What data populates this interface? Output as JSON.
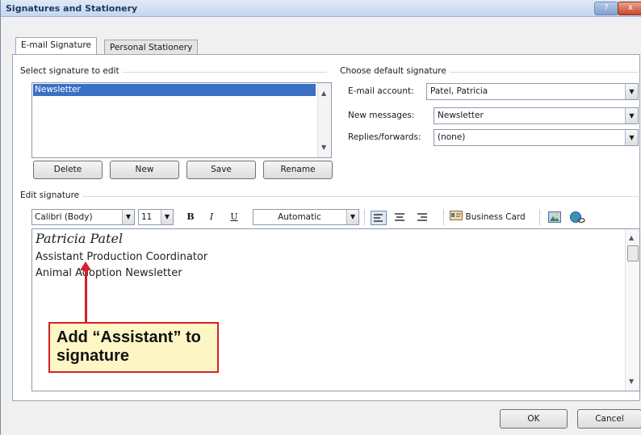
{
  "window": {
    "title": "Signatures and Stationery",
    "help_glyph": "?",
    "close_glyph": "x"
  },
  "tabs": [
    {
      "label": "E-mail Signature"
    },
    {
      "label": "Personal Stationery"
    }
  ],
  "select_section": {
    "label": "Select signature to edit",
    "items": [
      "Newsletter"
    ],
    "buttons": {
      "delete": "Delete",
      "new": "New",
      "save": "Save",
      "rename": "Rename"
    }
  },
  "default_section": {
    "label": "Choose default signature",
    "email_account": {
      "label": "E-mail account:",
      "value": "Patel, Patricia"
    },
    "new_messages": {
      "label": "New messages:",
      "value": "Newsletter"
    },
    "replies": {
      "label": "Replies/forwards:",
      "value": "(none)"
    }
  },
  "edit_section": {
    "label": "Edit signature",
    "toolbar": {
      "font": "Calibri (Body)",
      "size": "11",
      "bold": "B",
      "italic": "I",
      "underline": "U",
      "color": "Automatic",
      "business_card": "Business Card"
    },
    "signature_lines": [
      "Patricia Patel",
      "Assistant Production Coordinator",
      "Animal Adoption Newsletter"
    ]
  },
  "callout": {
    "text": "Add “Assistant” to signature",
    "color": "#d4202a"
  },
  "footer": {
    "ok": "OK",
    "cancel": "Cancel"
  },
  "icons": {
    "dropdown": "▼",
    "scroll_up": "▲",
    "scroll_down": "▼"
  }
}
